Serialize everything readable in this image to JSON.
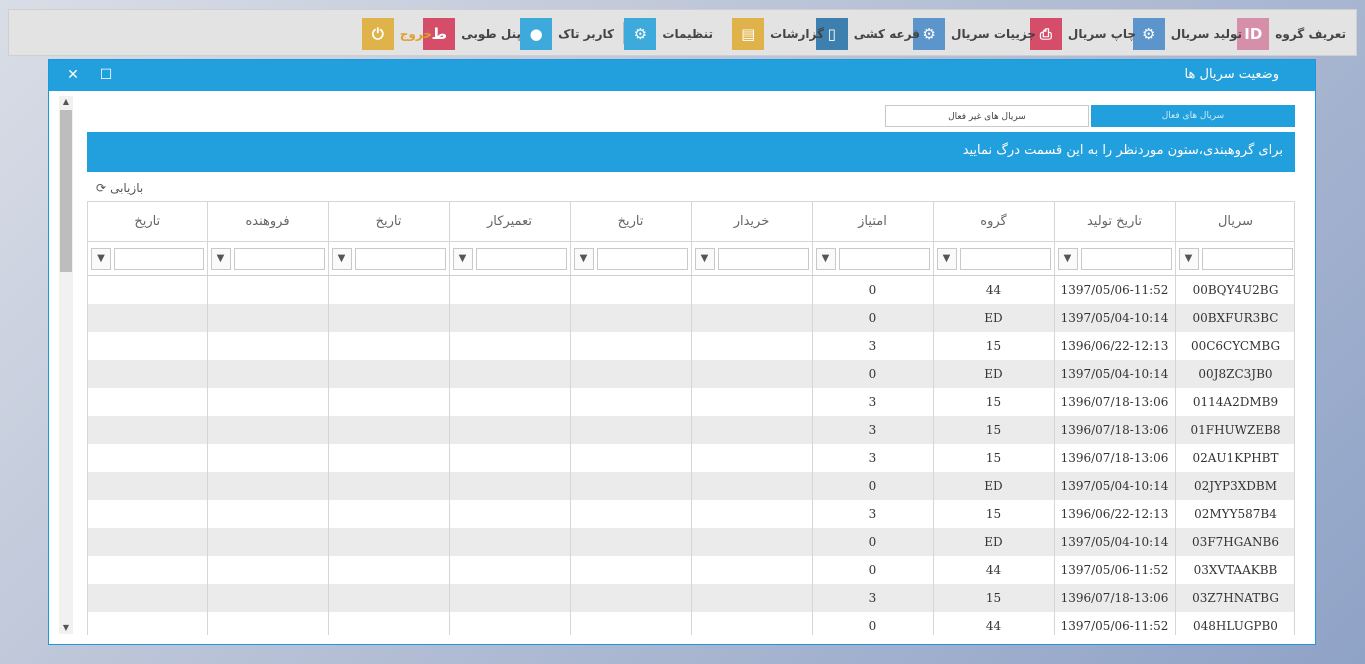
{
  "toolbar": {
    "items": [
      {
        "label": "تعریف گروه",
        "icon": "id-card-icon",
        "glyph": "ID",
        "color": "#d58fa8"
      },
      {
        "label": "تولید سریال",
        "icon": "gears-icon",
        "glyph": "⚙",
        "color": "#5c95cb"
      },
      {
        "label": "چاپ سریال",
        "icon": "printer-icon",
        "glyph": "⎙",
        "color": "#d64d6a"
      },
      {
        "label": "جزییات سریال",
        "icon": "gears-icon",
        "glyph": "⚙",
        "color": "#5c95cb"
      },
      {
        "label": "قرعه کشی",
        "icon": "mobile-icon",
        "glyph": "▯",
        "color": "#3d7fae"
      },
      {
        "label": "گزارشات",
        "icon": "report-icon",
        "glyph": "▤",
        "color": "#e0b24a"
      },
      {
        "label": "تنظیمات",
        "icon": "settings-icon",
        "glyph": "⚙",
        "color": "#3eaadb"
      },
      {
        "label": "کاربر تاک",
        "icon": "user-icon",
        "glyph": "●",
        "color": "#3eaadb"
      },
      {
        "label": "پنل طوبی",
        "icon": "tooba-icon",
        "glyph": "ط",
        "color": "#d64d6a"
      },
      {
        "label": "خروج",
        "icon": "power-icon",
        "glyph": "⏻",
        "color": "#e0b24a"
      }
    ]
  },
  "window": {
    "title": "وضعیت سریال ها",
    "close": "✕",
    "maximize": "☐"
  },
  "tabs": {
    "active": "سریال های فعال",
    "inactive": "سریال های غیر فعال"
  },
  "group_banner": "برای گروهبندی،ستون موردنظر را به این قسمت درگ نمایید",
  "refresh_label": "بازیابی",
  "table": {
    "columns": [
      "سریال",
      "تاریخ تولید",
      "گروه",
      "امتیاز",
      "خریدار",
      "تاریخ",
      "تعمیرکار",
      "تاریخ",
      "فروهنده",
      "تاریخ"
    ],
    "rows": [
      [
        "00BQY4U2BG",
        "1397/05/06-11:52",
        "44",
        "0"
      ],
      [
        "00BXFUR3BC",
        "1397/05/04-10:14",
        "ED",
        "0"
      ],
      [
        "00C6CYCMBG",
        "1396/06/22-12:13",
        "15",
        "3"
      ],
      [
        "00J8ZC3JB0",
        "1397/05/04-10:14",
        "ED",
        "0"
      ],
      [
        "0114A2DMB9",
        "1396/07/18-13:06",
        "15",
        "3"
      ],
      [
        "01FHUWZEB8",
        "1396/07/18-13:06",
        "15",
        "3"
      ],
      [
        "02AU1KPHBT",
        "1396/07/18-13:06",
        "15",
        "3"
      ],
      [
        "02JYP3XDBM",
        "1397/05/04-10:14",
        "ED",
        "0"
      ],
      [
        "02MYY587B4",
        "1396/06/22-12:13",
        "15",
        "3"
      ],
      [
        "03F7HGANB6",
        "1397/05/04-10:14",
        "ED",
        "0"
      ],
      [
        "03XVTAAKBB",
        "1397/05/06-11:52",
        "44",
        "0"
      ],
      [
        "03Z7HNATBG",
        "1396/07/18-13:06",
        "15",
        "3"
      ],
      [
        "048HLUGPB0",
        "1397/05/06-11:52",
        "44",
        "0"
      ]
    ]
  },
  "colors": {
    "accent": "#229fdd",
    "row_alt": "#ebebeb",
    "exit_text": "#e0a030"
  }
}
